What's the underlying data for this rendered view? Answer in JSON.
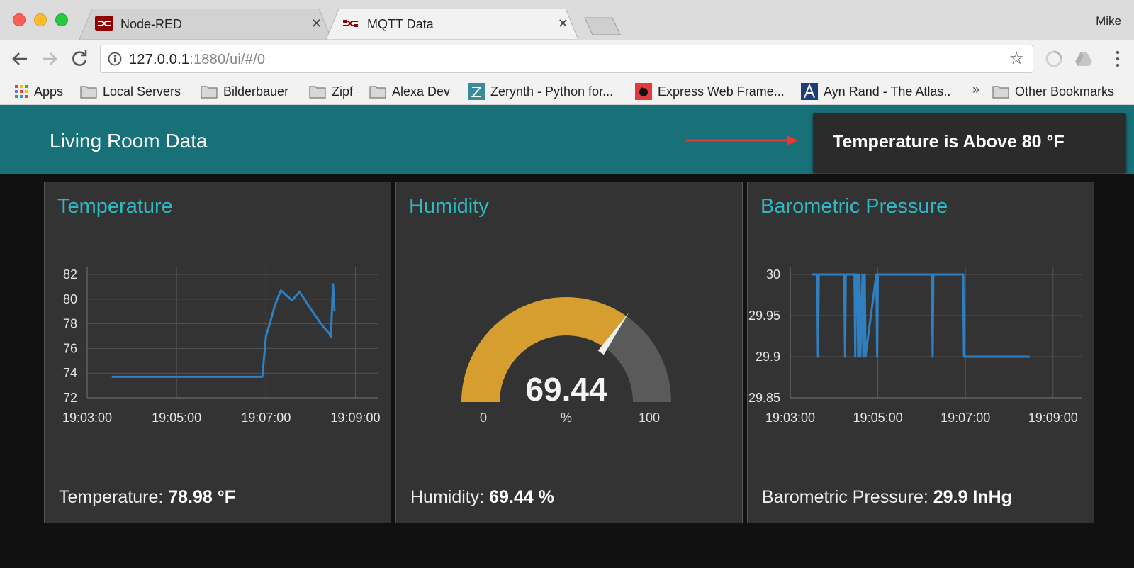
{
  "browser": {
    "tabs": [
      {
        "label": "Node-RED",
        "active": false
      },
      {
        "label": "MQTT Data",
        "active": true
      }
    ],
    "profile_name": "Mike",
    "url_host": "127.0.0.1",
    "url_rest": ":1880/ui/#/0",
    "bookmarks": [
      {
        "label": "Apps",
        "icon": "apps-grid-icon"
      },
      {
        "label": "Local Servers",
        "icon": "folder-icon"
      },
      {
        "label": "Bilderbauer",
        "icon": "folder-icon"
      },
      {
        "label": "Zipf",
        "icon": "folder-icon"
      },
      {
        "label": "Alexa Dev",
        "icon": "folder-icon"
      },
      {
        "label": "Zerynth - Python for...",
        "icon": "zerynth-icon"
      },
      {
        "label": "Express Web Frame...",
        "icon": "express-icon"
      },
      {
        "label": "Ayn Rand - The Atlas..",
        "icon": "atlas-icon"
      },
      {
        "label": "Other Bookmarks",
        "icon": "folder-icon"
      }
    ],
    "overflow_chevron": "»"
  },
  "dashboard": {
    "title": "Living Room Data",
    "notification": "Temperature is Above 80 °F",
    "colors": {
      "header": "#187178",
      "card": "#333333",
      "accent": "#2eb8c2",
      "line": "#2f7fc1",
      "gauge_fill": "#d69e2e"
    }
  },
  "temperature": {
    "title": "Temperature",
    "footer_label": "Temperature: ",
    "footer_value": "78.98 °F"
  },
  "humidity": {
    "title": "Humidity",
    "footer_label": "Humidity: ",
    "footer_value": "69.44 %",
    "gauge_value": "69.44",
    "gauge_units": "%",
    "gauge_min": "0",
    "gauge_max": "100"
  },
  "pressure": {
    "title": "Barometric Pressure",
    "footer_label": "Barometric Pressure: ",
    "footer_value": "29.9 InHg"
  },
  "chart_data": [
    {
      "type": "line",
      "title": "Temperature",
      "x_ticks": [
        "19:03:00",
        "19:05:00",
        "19:07:00",
        "19:09:00"
      ],
      "y_ticks": [
        "82",
        "80",
        "78",
        "76",
        "74",
        "72"
      ],
      "ylim": [
        72,
        82
      ],
      "xlim": [
        "19:03:00",
        "19:09:30"
      ],
      "grid": true,
      "series": [
        {
          "x": [
            "19:03:33",
            "19:04:30",
            "19:05:40",
            "19:06:40",
            "19:06:55",
            "19:07:00",
            "19:07:05",
            "19:07:12",
            "19:07:20",
            "19:07:35",
            "19:07:45",
            "19:08:00",
            "19:08:15",
            "19:08:25",
            "19:08:27",
            "19:08:30",
            "19:08:32"
          ],
          "values": [
            73.7,
            73.7,
            73.7,
            73.7,
            73.7,
            77.0,
            78.0,
            79.5,
            80.7,
            79.9,
            80.6,
            79.2,
            77.9,
            77.2,
            76.9,
            81.2,
            79.0
          ]
        }
      ]
    },
    {
      "type": "gauge",
      "title": "Humidity",
      "value": 69.44,
      "min": 0,
      "max": 100,
      "units": "%"
    },
    {
      "type": "line",
      "title": "Barometric Pressure",
      "x_ticks": [
        "19:03:00",
        "19:05:00",
        "19:07:00",
        "19:09:00"
      ],
      "y_ticks": [
        "30",
        "29.95",
        "29.9",
        "29.85"
      ],
      "ylim": [
        29.85,
        30.0
      ],
      "xlim": [
        "19:03:00",
        "19:09:40"
      ],
      "grid": true,
      "series": [
        {
          "x": [
            "19:03:30",
            "19:03:37",
            "19:03:38",
            "19:03:39",
            "19:04:14",
            "19:04:15",
            "19:04:16",
            "19:04:28",
            "19:04:29",
            "19:04:30",
            "19:04:32",
            "19:04:33",
            "19:04:35",
            "19:04:36",
            "19:04:39",
            "19:04:40",
            "19:04:42",
            "19:04:43",
            "19:04:58",
            "19:04:59",
            "19:05:00",
            "19:06:14",
            "19:06:15",
            "19:06:16",
            "19:06:57",
            "19:06:58",
            "19:08:28"
          ],
          "values": [
            30,
            30,
            29.9,
            30,
            30,
            29.9,
            30,
            30,
            29.9,
            30,
            30,
            29.9,
            30,
            29.9,
            30,
            29.9,
            30,
            29.9,
            30,
            29.9,
            30,
            30,
            29.9,
            30,
            30,
            29.9,
            29.9
          ]
        }
      ]
    }
  ]
}
